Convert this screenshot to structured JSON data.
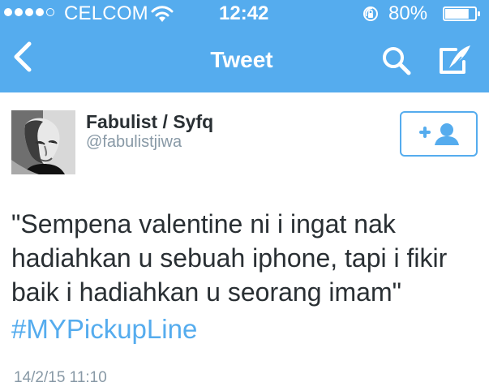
{
  "status_bar": {
    "carrier": "CELCOM",
    "time": "12:42",
    "battery": "80%",
    "signal_strength": 4,
    "signal_total": 5,
    "battery_level_fraction": 0.8
  },
  "navigation": {
    "title": "Tweet",
    "back_icon": "chevron-left-icon",
    "search_icon": "search-icon",
    "compose_icon": "compose-tweet-icon"
  },
  "tweet": {
    "author_name": "Fabulist / Syfq",
    "author_handle": "@fabulistjiwa",
    "text_lines": [
      "\"Sempena valentine ni i ingat nak",
      "hadiahkan u sebuah iphone, tapi i fikir",
      "baik i hadiahkan u seorang imam\""
    ],
    "hashtag": "#MYPickupLine",
    "timestamp": "14/2/15 11:10",
    "follow_icon": "follow-user-icon"
  },
  "colors": {
    "accent": "#55acee",
    "text": "#292f33",
    "secondary_text": "#8899a6"
  }
}
